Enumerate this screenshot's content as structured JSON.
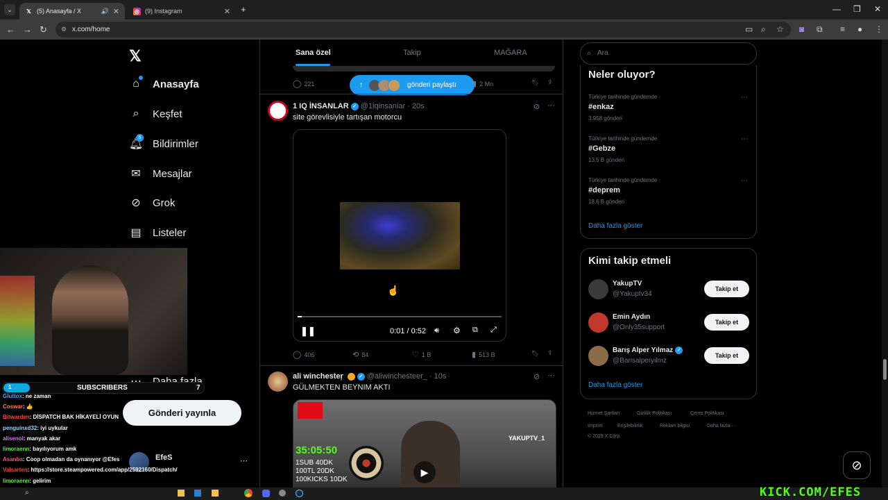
{
  "browser": {
    "tabs": [
      {
        "title": "(5) Anasayfa / X",
        "favicon": "x-favicon",
        "active": true
      },
      {
        "title": "(9) Instagram",
        "favicon": "instagram-favicon",
        "active": false
      }
    ],
    "url": "x.com/home"
  },
  "nav": {
    "items": [
      {
        "label": "Anasayfa",
        "icon": "home-icon"
      },
      {
        "label": "Keşfet",
        "icon": "search-icon"
      },
      {
        "label": "Bildirimler",
        "icon": "bell-icon",
        "badge": "5"
      },
      {
        "label": "Mesajlar",
        "icon": "mail-icon"
      },
      {
        "label": "Grok",
        "icon": "grok-icon"
      },
      {
        "label": "Listeler",
        "icon": "list-icon"
      },
      {
        "label": "etleri",
        "icon": "bookmark-icon"
      },
      {
        "label": "klar",
        "icon": "communities-icon"
      },
      {
        "label": "m",
        "icon": "premium-icon"
      },
      {
        "label": "Daha fazla",
        "icon": "more-icon"
      }
    ],
    "post_button": "Gönderi yayınla",
    "account_name": "EfeS"
  },
  "feed": {
    "tabs": [
      "Sana özel",
      "Takip",
      "MAĞARA"
    ],
    "prev_post": {
      "replies": "221",
      "views": "2 Mn"
    },
    "new_posts_pill": "gönderi paylaştı",
    "post1": {
      "name": "1 IQ İNSANLAR",
      "handle": "@1iqinsaniar · 20s",
      "text": "site görevlisiyle tartışan motorcu",
      "time": "0:01 / 0:52",
      "replies": "406",
      "reposts": "84",
      "likes": "1 B",
      "views": "513 B"
    },
    "post2": {
      "name": "ali winchesteŗ",
      "handle": "@aliwinchesteer_ · 10s",
      "text": "GÜLMEKTEN BEYNIM AKTI",
      "overlay_tag": "YAKUPTV_1",
      "overlay_timer": "35:05:50",
      "overlay_lines": [
        "1SUB 40DK",
        "100TL 20DK",
        "100KICKS 10DK"
      ]
    }
  },
  "sidebar": {
    "search_placeholder": "Ara",
    "trends_title": "Neler oluyor?",
    "trends": [
      {
        "meta": "Türkiye tarihinde gündemde",
        "tag": "#enkaz",
        "count": "3.958 gönderi"
      },
      {
        "meta": "Türkiye tarihinde gündemde",
        "tag": "#Gebze",
        "count": "13,5 B gönderi"
      },
      {
        "meta": "Türkiye tarihinde gündemde",
        "tag": "#deprem",
        "count": "18,6 B gönderi"
      }
    ],
    "show_more": "Daha fazla göster",
    "follow_title": "Kimi takip etmeli",
    "follow": [
      {
        "name": "YakupTV",
        "handle": "@Yakuptv34",
        "button": "Takip et",
        "verified": false,
        "color": "#3a3a3a"
      },
      {
        "name": "Emin Aydın",
        "handle": "@Only35support",
        "button": "Takip et",
        "verified": false,
        "color": "#c0392b"
      },
      {
        "name": "Barış Alper Yılmaz",
        "handle": "@Barisalperyilmz",
        "button": "Takip et",
        "verified": true,
        "color": "#8b6b4a"
      }
    ],
    "footer": [
      "Hizmet Şartları",
      "Gizlilik Politikası",
      "Çerez Politikası",
      "Imprint",
      "Erişilebilirlik",
      "Reklam bilgisi",
      "Daha fazla ···",
      "© 2025 X Corp."
    ]
  },
  "stream": {
    "subscribers_label": "SUBSCRIBERS",
    "subscribers_count": "7",
    "subscribers_current": "1",
    "chat": [
      {
        "user": "Gluttox",
        "msg": ": ne zaman",
        "color": "#5b9cf2"
      },
      {
        "user": "Coswar",
        "msg": ": 👍",
        "color": "#ff7f50"
      },
      {
        "user": "Bitwarden",
        "msg": ": DİSPATCH BAK HİKAYELİ OYUN",
        "color": "#ff4040"
      },
      {
        "user": "penguinxd32",
        "msg": ": iyi uykular",
        "color": "#9ad7ff"
      },
      {
        "user": "alisenol",
        "msg": ": manyak akar",
        "color": "#d07cff"
      },
      {
        "user": "limoraenn",
        "msg": ": bayılıyorum amk",
        "color": "#53fc18"
      },
      {
        "user": "Asanba",
        "msg": ": Coop olmadan da oynanıyor @Efes",
        "color": "#ff4d8d"
      },
      {
        "user": "Valsarten",
        "msg": ": https://store.steampowered.com/app/2592160/Dispatch/",
        "color": "#ff4040"
      },
      {
        "user": "limoraenn",
        "msg": ": gelirim",
        "color": "#53fc18"
      }
    ],
    "kick_text": "KICK.COM/EFES"
  }
}
